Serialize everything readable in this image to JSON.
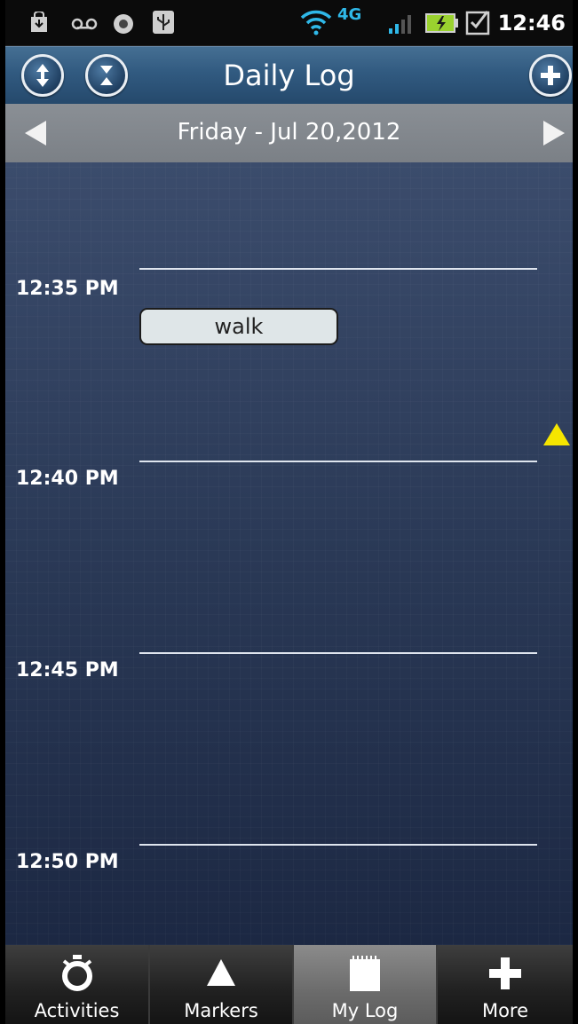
{
  "status_bar": {
    "time": "12:46",
    "network": "4G",
    "icons": [
      "shopping-bag-download-icon",
      "voicemail-icon",
      "record-icon",
      "usb-icon",
      "wifi-icon",
      "4g-lte-icon",
      "signal-icon",
      "battery-charging-icon",
      "checkbox-task-icon"
    ]
  },
  "header": {
    "title": "Daily Log",
    "expand_icon": "expand-vertical-icon",
    "collapse_icon": "collapse-vertical-icon",
    "add_icon": "plus-icon"
  },
  "date_nav": {
    "date": "Friday - Jul 20,2012",
    "prev_icon": "triangle-left-icon",
    "next_icon": "triangle-right-icon"
  },
  "timeline": {
    "slots": [
      {
        "label": "12:35 PM"
      },
      {
        "label": "12:40 PM"
      },
      {
        "label": "12:45 PM"
      },
      {
        "label": "12:50 PM"
      }
    ],
    "events": [
      {
        "label": "walk"
      }
    ],
    "marker_color": "#f5e500"
  },
  "tabs": [
    {
      "label": "Activities",
      "icon": "stopwatch-icon",
      "active": false
    },
    {
      "label": "Markers",
      "icon": "triangle-marker-icon",
      "active": false
    },
    {
      "label": "My Log",
      "icon": "notepad-icon",
      "active": true
    },
    {
      "label": "More",
      "icon": "plus-icon",
      "active": false
    }
  ]
}
